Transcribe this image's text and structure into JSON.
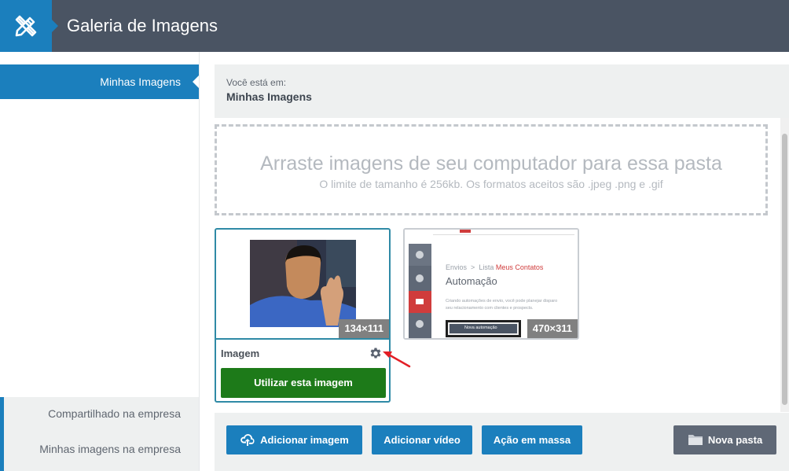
{
  "header": {
    "title": "Galeria de Imagens",
    "logo_icon": "pencil-ruler-icon",
    "color": "#4a5463",
    "accent": "#1b7fbd"
  },
  "sidebar": {
    "active_item": "Minhas Imagens",
    "bottom_items": [
      "Compartilhado na empresa",
      "Minhas imagens na empresa"
    ]
  },
  "breadcrumb": {
    "label": "Você está em:",
    "value": "Minhas Imagens"
  },
  "dropzone": {
    "title": "Arraste imagens de seu computador para essa pasta",
    "subtitle": "O limite de tamanho é 256kb. Os formatos aceitos são .jpeg .png e .gif"
  },
  "images": [
    {
      "dimensions": "134×111",
      "name": "Imagem",
      "selected": true,
      "use_button": "Utilizar esta imagem",
      "settings_icon": "gear-icon"
    },
    {
      "dimensions": "470×311",
      "selected": false,
      "screenshot": {
        "breadcrumb_1": "Envios",
        "breadcrumb_sep": ">",
        "breadcrumb_2": "Lista",
        "breadcrumb_3": "Meus Contatos",
        "title": "Automação",
        "text_line_1": "Criando automações de envio, você pode planejar disparo",
        "text_line_2": "seu relacionamento com clientes e prospects.",
        "button": "Nova automação"
      }
    }
  ],
  "toolbar": {
    "add_image": "Adicionar imagem",
    "add_video": "Adicionar vídeo",
    "bulk_action": "Ação em massa",
    "new_folder": "Nova pasta"
  },
  "colors": {
    "green": "#1d7a19",
    "selected_border": "#2f8aa6",
    "red_arrow": "#e21f26"
  }
}
